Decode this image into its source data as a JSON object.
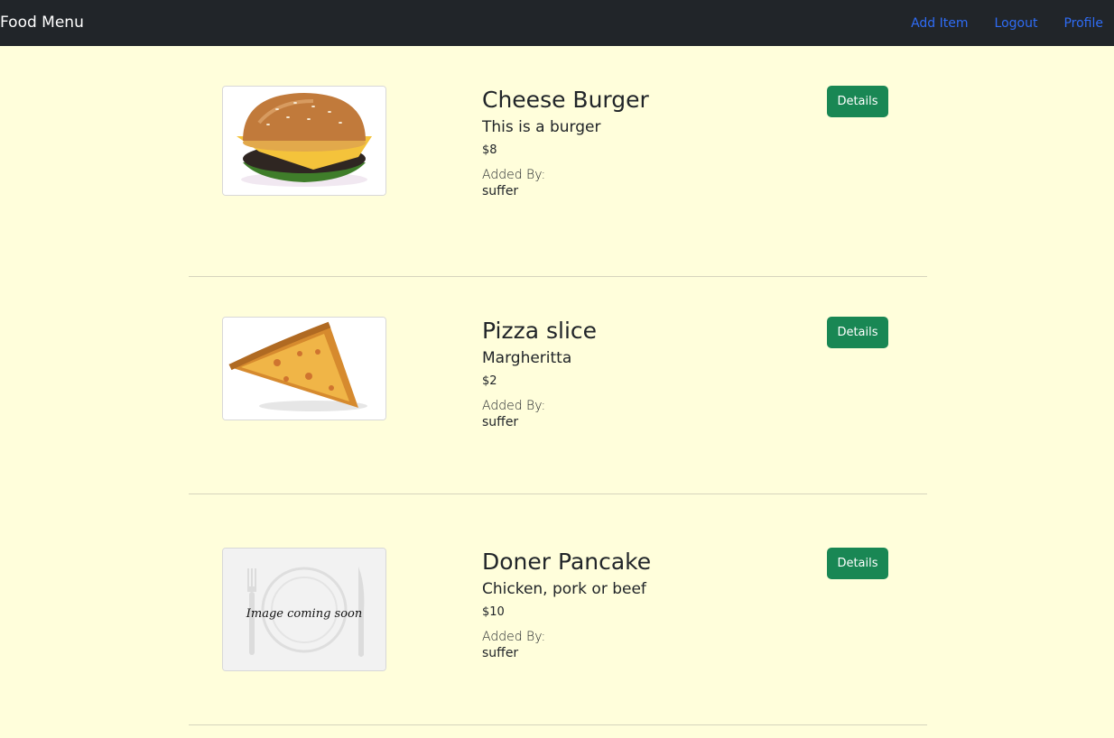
{
  "navbar": {
    "brand": "Food Menu",
    "links": [
      "Add Item",
      "Logout",
      "Profile"
    ]
  },
  "menu": {
    "items": [
      {
        "name": "Cheese Burger",
        "description": "This is a burger",
        "price": "$8",
        "added_by_label": "Added By:",
        "added_by": "suffer",
        "details_label": "Details",
        "image": "burger-photo"
      },
      {
        "name": "Pizza slice",
        "description": "Margheritta",
        "price": "$2",
        "added_by_label": "Added By:",
        "added_by": "suffer",
        "details_label": "Details",
        "image": "pizza-photo"
      },
      {
        "name": "Doner Pancake",
        "description": "Chicken, pork or beef",
        "price": "$10",
        "added_by_label": "Added By:",
        "added_by": "suffer",
        "details_label": "Details",
        "image": "image-coming-soon-placeholder",
        "placeholder_text": "Image coming soon"
      }
    ]
  },
  "colors": {
    "page_background": "#fffedb",
    "navbar": "#212529",
    "nav_link": "#2f6cf5",
    "details_button": "#198754"
  }
}
